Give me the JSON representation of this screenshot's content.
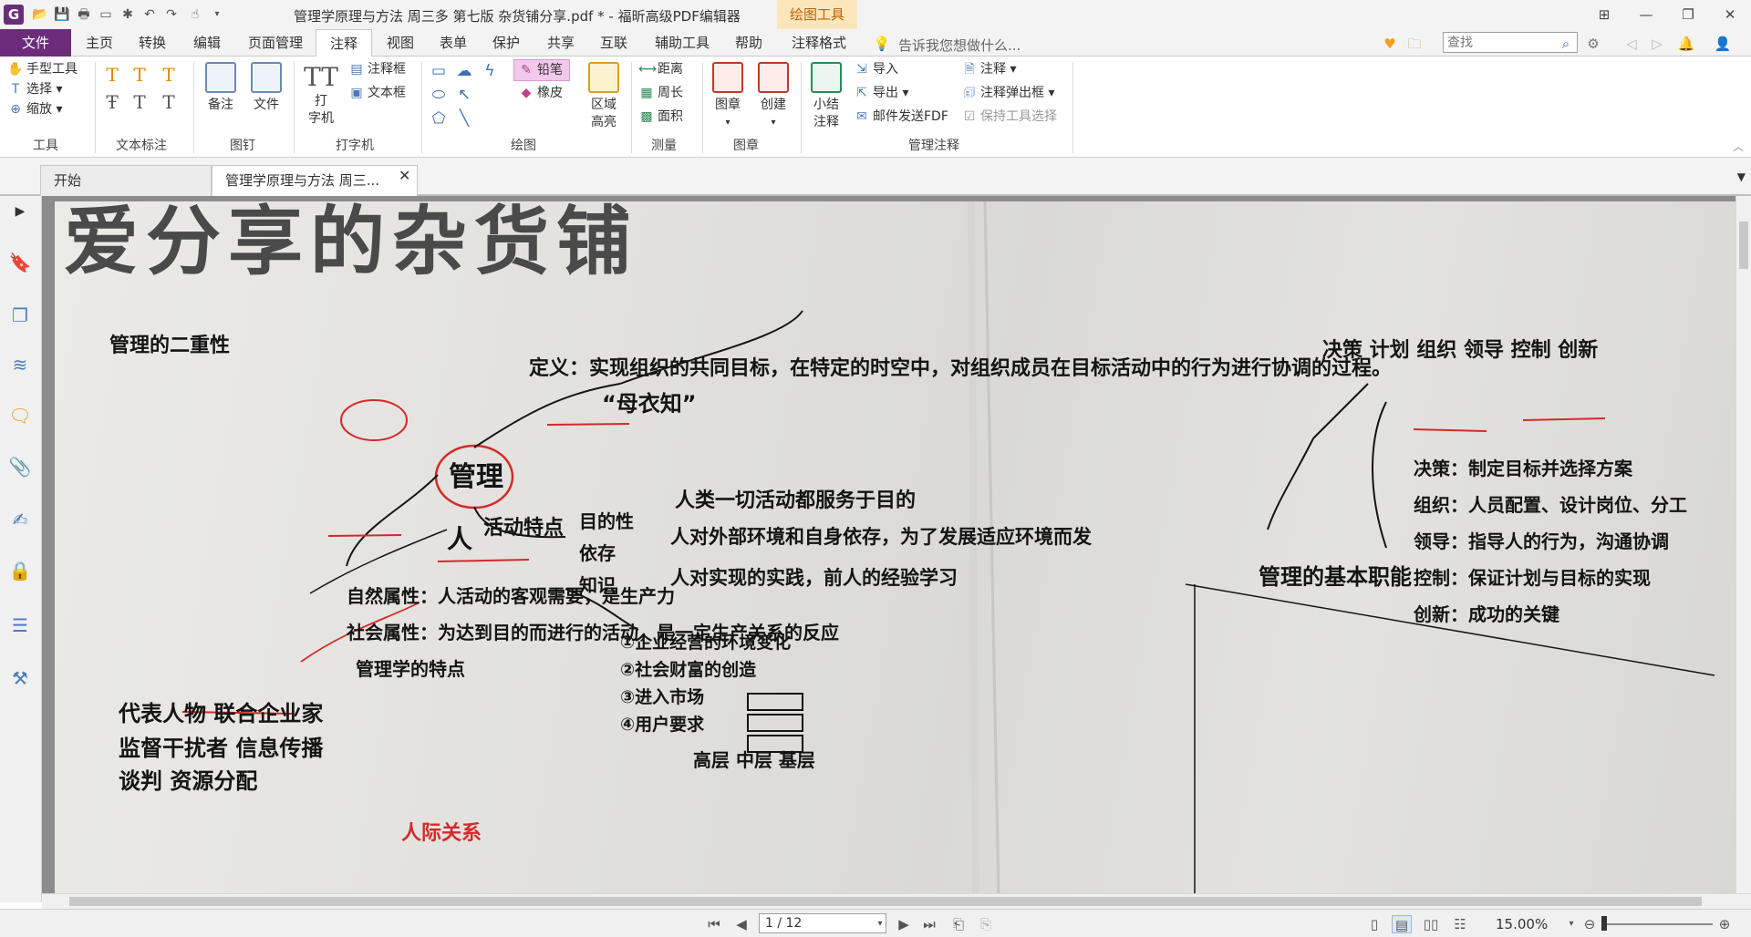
{
  "titlebar": {
    "window_title": "管理学原理与方法  周三多  第七版  杂货铺分享.pdf * - 福昕高级PDF编辑器",
    "context_tab": "绘图工具",
    "icons": [
      "app-logo",
      "open-icon",
      "save-icon",
      "print-icon",
      "scan-icon",
      "create-icon",
      "undo-icon",
      "redo-icon",
      "hand-icon",
      "customize-icon"
    ],
    "win_buttons": [
      "layout-icon",
      "minimize-icon",
      "restore-icon",
      "close-icon"
    ]
  },
  "menu": {
    "file": "文件",
    "tabs": [
      "主页",
      "转换",
      "编辑",
      "页面管理",
      "注释",
      "视图",
      "表单",
      "保护",
      "共享",
      "互联",
      "辅助工具",
      "帮助",
      "注释格式"
    ],
    "active_tab": "注释",
    "tell_me": "告诉我您想做什么...",
    "search_placeholder": "查找"
  },
  "ribbon": {
    "tools": {
      "hand": "手型工具",
      "select": "选择",
      "zoom": "缩放",
      "label": "工具"
    },
    "text_markup": {
      "label": "文本标注"
    },
    "pin": {
      "note": "备注",
      "file": "文件",
      "label": "图钉"
    },
    "typewriter": {
      "typewriter_l1": "打",
      "typewriter_l2": "字机",
      "callout": "注释框",
      "textbox": "文本框",
      "label": "打字机"
    },
    "drawing": {
      "pencil": "铅笔",
      "eraser": "橡皮",
      "area_hl_l1": "区域",
      "area_hl_l2": "高亮",
      "label": "绘图"
    },
    "measure": {
      "distance": "距离",
      "perimeter": "周长",
      "area": "面积",
      "label": "测量"
    },
    "stamp": {
      "stamp": "图章",
      "create": "创建",
      "label": "图章"
    },
    "manage": {
      "summary_l1": "小结",
      "summary_l2": "注释",
      "import": "导入",
      "export": "导出",
      "email_fdf": "邮件发送FDF",
      "comments": "注释",
      "popup": "注释弹出框",
      "keep_tool": "保持工具选择",
      "label": "管理注释"
    }
  },
  "doctabs": {
    "start": "开始",
    "current": "管理学原理与方法  周三..."
  },
  "document": {
    "heading": "爱分享的杂货铺",
    "notes": [
      "定义：实现组织的共同目标，在特定的时空中，对组织成员在目标活动中的行为进行协调的过程。",
      "“母衣知”",
      "管理",
      "人",
      "活动特点",
      "目的性",
      "依存",
      "知识",
      "人类一切活动都服务于目的",
      "人对外部环境和自身依存，为了发展适应环境而发",
      "人对实现的实践，前人的经验学习",
      "管理的二重性",
      "自然属性：人活动的客观需要，是生产力",
      "社会属性：为达到目的而进行的活动，是一定生产关系的反应",
      "管理学的特点",
      "代表人物 联合企业家",
      "监督干扰者 信息传播",
      "谈判 资源分配",
      "决策 计划 组织 领导 控制 创新",
      "管理的基本职能",
      "决策：制定目标并选择方案",
      "组织：人员配置、设计岗位、分工",
      "领导：指导人的行为，沟通协调",
      "控制：保证计划与目标的实现",
      "创新：成功的关键",
      "①企业经营的环境变化",
      "②社会财富的创造",
      "③进入市场",
      "④用户要求",
      "高层 中层 基层",
      "人际关系"
    ]
  },
  "statusbar": {
    "page": "1 / 12",
    "zoom": "15.00%"
  },
  "colors": {
    "brand": "#6b2d7a",
    "context_tab_bg": "#fbe6bc",
    "accent_blue": "#4a7cc0",
    "annotation_red": "#d22a2a",
    "ink": "#141414"
  }
}
